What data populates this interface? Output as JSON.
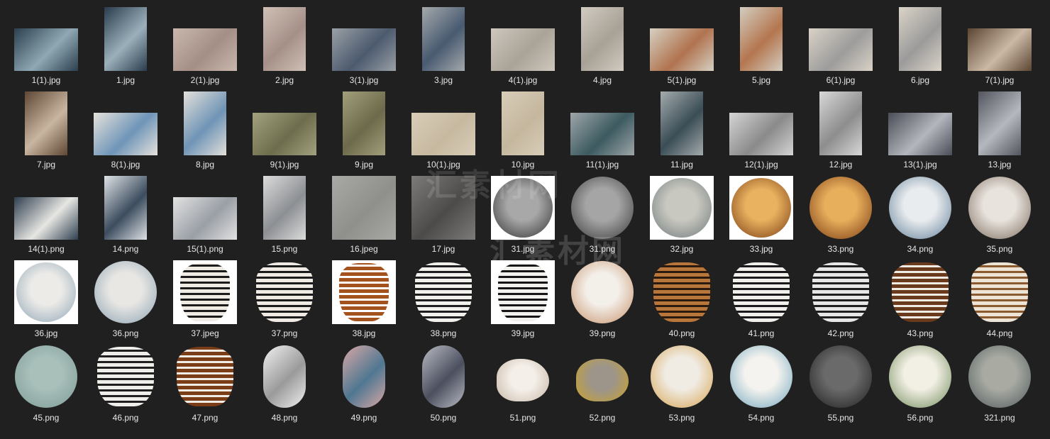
{
  "watermark": {
    "line1": "汇素材网",
    "line2": "汇素材网"
  },
  "items": [
    {
      "name": "1(1).jpg",
      "kind": "L",
      "c": [
        "#2c3f4e",
        "#8fa8b4"
      ]
    },
    {
      "name": "1.jpg",
      "kind": "P",
      "c": [
        "#2a3c4c",
        "#9bb0bb"
      ]
    },
    {
      "name": "2(1).jpg",
      "kind": "L",
      "c": [
        "#c9b7ad",
        "#a48f86"
      ]
    },
    {
      "name": "2.jpg",
      "kind": "P",
      "c": [
        "#d0c0b6",
        "#a59088"
      ]
    },
    {
      "name": "3(1).jpg",
      "kind": "L",
      "c": [
        "#9aa0a6",
        "#4c5a6e"
      ]
    },
    {
      "name": "3.jpg",
      "kind": "P",
      "c": [
        "#a4a9ac",
        "#485a70"
      ]
    },
    {
      "name": "4(1).jpg",
      "kind": "L",
      "c": [
        "#cdc7bd",
        "#a9a398"
      ]
    },
    {
      "name": "4.jpg",
      "kind": "P",
      "c": [
        "#d1cbc1",
        "#a7a196"
      ]
    },
    {
      "name": "5(1).jpg",
      "kind": "L",
      "c": [
        "#d6d0c3",
        "#b0734f"
      ]
    },
    {
      "name": "5.jpg",
      "kind": "P",
      "c": [
        "#d3cdc0",
        "#b4764f"
      ]
    },
    {
      "name": "6(1).jpg",
      "kind": "L",
      "c": [
        "#d9d2c6",
        "#9d9c9c"
      ]
    },
    {
      "name": "6.jpg",
      "kind": "P",
      "c": [
        "#dad3c7",
        "#9c9b9b"
      ]
    },
    {
      "name": "7(1).jpg",
      "kind": "L",
      "c": [
        "#5b4532",
        "#cbb9a5"
      ]
    },
    {
      "name": "7.jpg",
      "kind": "P",
      "c": [
        "#5e4734",
        "#c9b6a1"
      ]
    },
    {
      "name": "8(1).jpg",
      "kind": "L",
      "c": [
        "#e6e2dc",
        "#6f95b8"
      ]
    },
    {
      "name": "8.jpg",
      "kind": "P",
      "c": [
        "#e3e0da",
        "#6f94b6"
      ]
    },
    {
      "name": "9(1).jpg",
      "kind": "L",
      "c": [
        "#a3a27f",
        "#6d6c4c"
      ]
    },
    {
      "name": "9.jpg",
      "kind": "P",
      "c": [
        "#a19f7b",
        "#6c6a4a"
      ]
    },
    {
      "name": "10(1).jpg",
      "kind": "L",
      "c": [
        "#d8cdb8",
        "#c7b9a0"
      ]
    },
    {
      "name": "10.jpg",
      "kind": "P",
      "c": [
        "#d8cdb8",
        "#c5b79e"
      ]
    },
    {
      "name": "11(1).jpg",
      "kind": "L",
      "c": [
        "#9ea6a9",
        "#3c5a60"
      ]
    },
    {
      "name": "11.jpg",
      "kind": "P",
      "c": [
        "#a4abad",
        "#3a4d55"
      ]
    },
    {
      "name": "12(1).jpg",
      "kind": "L",
      "c": [
        "#d5d5d5",
        "#8a8a8a"
      ]
    },
    {
      "name": "12.jpg",
      "kind": "P",
      "c": [
        "#d8d8d8",
        "#8d8d8d"
      ]
    },
    {
      "name": "13(1).jpg",
      "kind": "L",
      "c": [
        "#4a4d55",
        "#b3b6bd"
      ]
    },
    {
      "name": "13.jpg",
      "kind": "P",
      "c": [
        "#52555d",
        "#b5b8be"
      ]
    },
    {
      "name": "14(1).png",
      "kind": "L",
      "c": [
        "#2f3f50",
        "#e6e6e2"
      ]
    },
    {
      "name": "14.png",
      "kind": "P",
      "c": [
        "#dfe3e6",
        "#3b4c5e"
      ]
    },
    {
      "name": "15(1).png",
      "kind": "L",
      "c": [
        "#e2e2e2",
        "#9a9fa6"
      ]
    },
    {
      "name": "15.png",
      "kind": "P",
      "c": [
        "#dcdcdc",
        "#8c8f93"
      ]
    },
    {
      "name": "16.jpeg",
      "kind": "S",
      "c": [
        "#a9a9a6",
        "#8f8f8c"
      ]
    },
    {
      "name": "17.jpg",
      "kind": "S",
      "c": [
        "#7d7b79",
        "#4d4b49"
      ]
    },
    {
      "name": "31.jpg",
      "kind": "W",
      "c": [
        "#a8a8a8",
        "#333333"
      ]
    },
    {
      "name": "31.png",
      "kind": "C",
      "c": [
        "#a5a5a5",
        "#3a3a3a"
      ]
    },
    {
      "name": "32.jpg",
      "kind": "W",
      "c": [
        "#c9c8c0",
        "#6f7a7c"
      ]
    },
    {
      "name": "33.jpg",
      "kind": "W",
      "c": [
        "#e8b260",
        "#7a3b12"
      ]
    },
    {
      "name": "33.png",
      "kind": "C",
      "c": [
        "#e7ae5c",
        "#783a12"
      ]
    },
    {
      "name": "34.png",
      "kind": "C",
      "c": [
        "#e9ecee",
        "#5f7e98"
      ]
    },
    {
      "name": "35.png",
      "kind": "C",
      "c": [
        "#e8e3dd",
        "#7b6a5b"
      ]
    },
    {
      "name": "36.jpg",
      "kind": "W",
      "c": [
        "#ecebe8",
        "#8ea5b5"
      ]
    },
    {
      "name": "36.png",
      "kind": "C",
      "c": [
        "#e8e7e4",
        "#8ba2b2"
      ]
    },
    {
      "name": "37.jpeg",
      "kind": "WH",
      "c": [
        "#efebe4",
        "#1b1b1b"
      ]
    },
    {
      "name": "37.png",
      "kind": "H",
      "c": [
        "#efebe4",
        "#1b1b1b"
      ]
    },
    {
      "name": "38.jpg",
      "kind": "WH",
      "c": [
        "#a4531f",
        "#ffffff"
      ]
    },
    {
      "name": "38.png",
      "kind": "H",
      "c": [
        "#f2f0ec",
        "#1d1d1d"
      ]
    },
    {
      "name": "39.jpg",
      "kind": "WH",
      "c": [
        "#f2f0ec",
        "#161616"
      ]
    },
    {
      "name": "39.png",
      "kind": "C",
      "c": [
        "#f3efe9",
        "#c7916a"
      ]
    },
    {
      "name": "40.png",
      "kind": "H",
      "c": [
        "#b9763a",
        "#2a1a10"
      ]
    },
    {
      "name": "41.png",
      "kind": "H",
      "c": [
        "#f1efeb",
        "#1a1a1a"
      ]
    },
    {
      "name": "42.png",
      "kind": "H",
      "c": [
        "#e6e6e6",
        "#1e1e1e"
      ]
    },
    {
      "name": "43.png",
      "kind": "H",
      "c": [
        "#6a3a1c",
        "#f0ebe5"
      ]
    },
    {
      "name": "44.png",
      "kind": "H",
      "c": [
        "#eee4d6",
        "#8a5a2e"
      ]
    },
    {
      "name": "45.png",
      "kind": "C",
      "c": [
        "#a8bfba",
        "#7d9a95"
      ]
    },
    {
      "name": "46.png",
      "kind": "H",
      "c": [
        "#f0eeea",
        "#202020"
      ]
    },
    {
      "name": "47.png",
      "kind": "H",
      "c": [
        "#7a3d18",
        "#f1ece6"
      ]
    },
    {
      "name": "48.png",
      "kind": "O",
      "c": [
        "#f1f1f1",
        "#9a9a9a"
      ]
    },
    {
      "name": "49.png",
      "kind": "O",
      "c": [
        "#d9a8a6",
        "#4f7791"
      ]
    },
    {
      "name": "50.png",
      "kind": "O",
      "c": [
        "#b9bcc4",
        "#4b4f5e"
      ]
    },
    {
      "name": "51.png",
      "kind": "B",
      "c": [
        "#f4efe9",
        "#c8b8a6"
      ]
    },
    {
      "name": "52.png",
      "kind": "B",
      "c": [
        "#9d958a",
        "#c9a22a"
      ]
    },
    {
      "name": "53.png",
      "kind": "C",
      "c": [
        "#f0ece4",
        "#d6a24e"
      ]
    },
    {
      "name": "54.png",
      "kind": "C",
      "c": [
        "#f5f3ef",
        "#6fa5bd"
      ]
    },
    {
      "name": "55.png",
      "kind": "C",
      "c": [
        "#6a6a6a",
        "#1e1e1e"
      ]
    },
    {
      "name": "56.png",
      "kind": "C",
      "c": [
        "#f2efe4",
        "#6f8a5a"
      ]
    },
    {
      "name": "321.png",
      "kind": "C",
      "c": [
        "#a9aba3",
        "#4f5a5c"
      ]
    }
  ]
}
